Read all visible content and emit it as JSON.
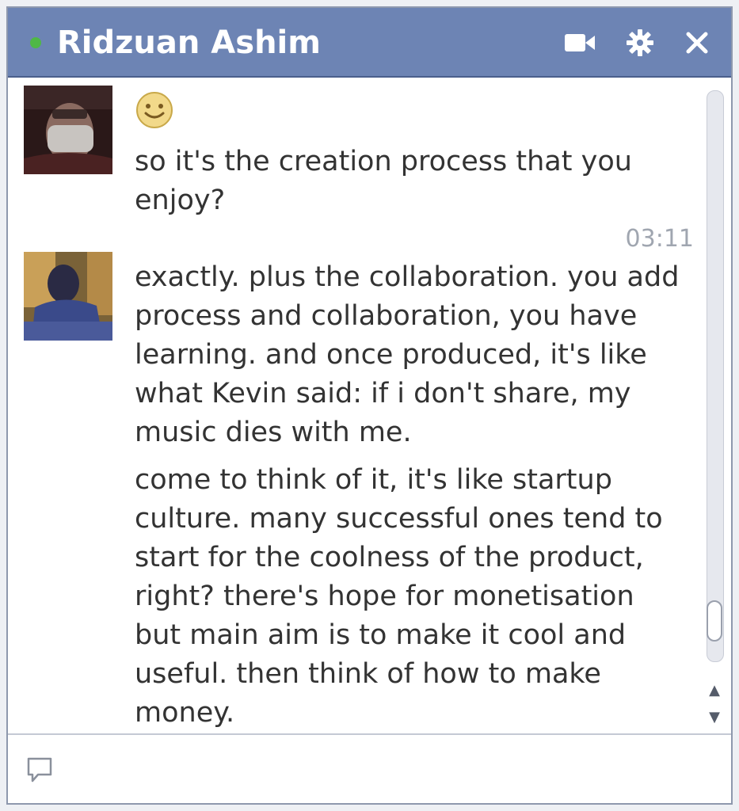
{
  "header": {
    "contact_name": "Ridzuan Ashim",
    "icons": [
      "presence-dot",
      "video-icon",
      "gear-icon",
      "close-icon"
    ],
    "colors": {
      "titlebar": "#6d84b4",
      "presence": "#4fb846"
    }
  },
  "messages": [
    {
      "sender_avatar": "avatar-1",
      "emoji": "smile",
      "text": "so it's the creation process that you enjoy?"
    },
    {
      "timestamp": "03:11"
    },
    {
      "sender_avatar": "avatar-2",
      "text": "exactly. plus the collaboration. you add process and collaboration, you have learning. and once produced, it's like what Kevin said: if i don't share, my music dies with me."
    },
    {
      "sender_avatar": "avatar-2",
      "text": "come to think of it, it's like startup culture.  many successful ones tend to start for the coolness of the product, right? there's hope for monetisation but main aim is to make it cool and useful. then think of how to make money."
    }
  ],
  "composer": {
    "value": "",
    "icon": "compose-icon"
  }
}
